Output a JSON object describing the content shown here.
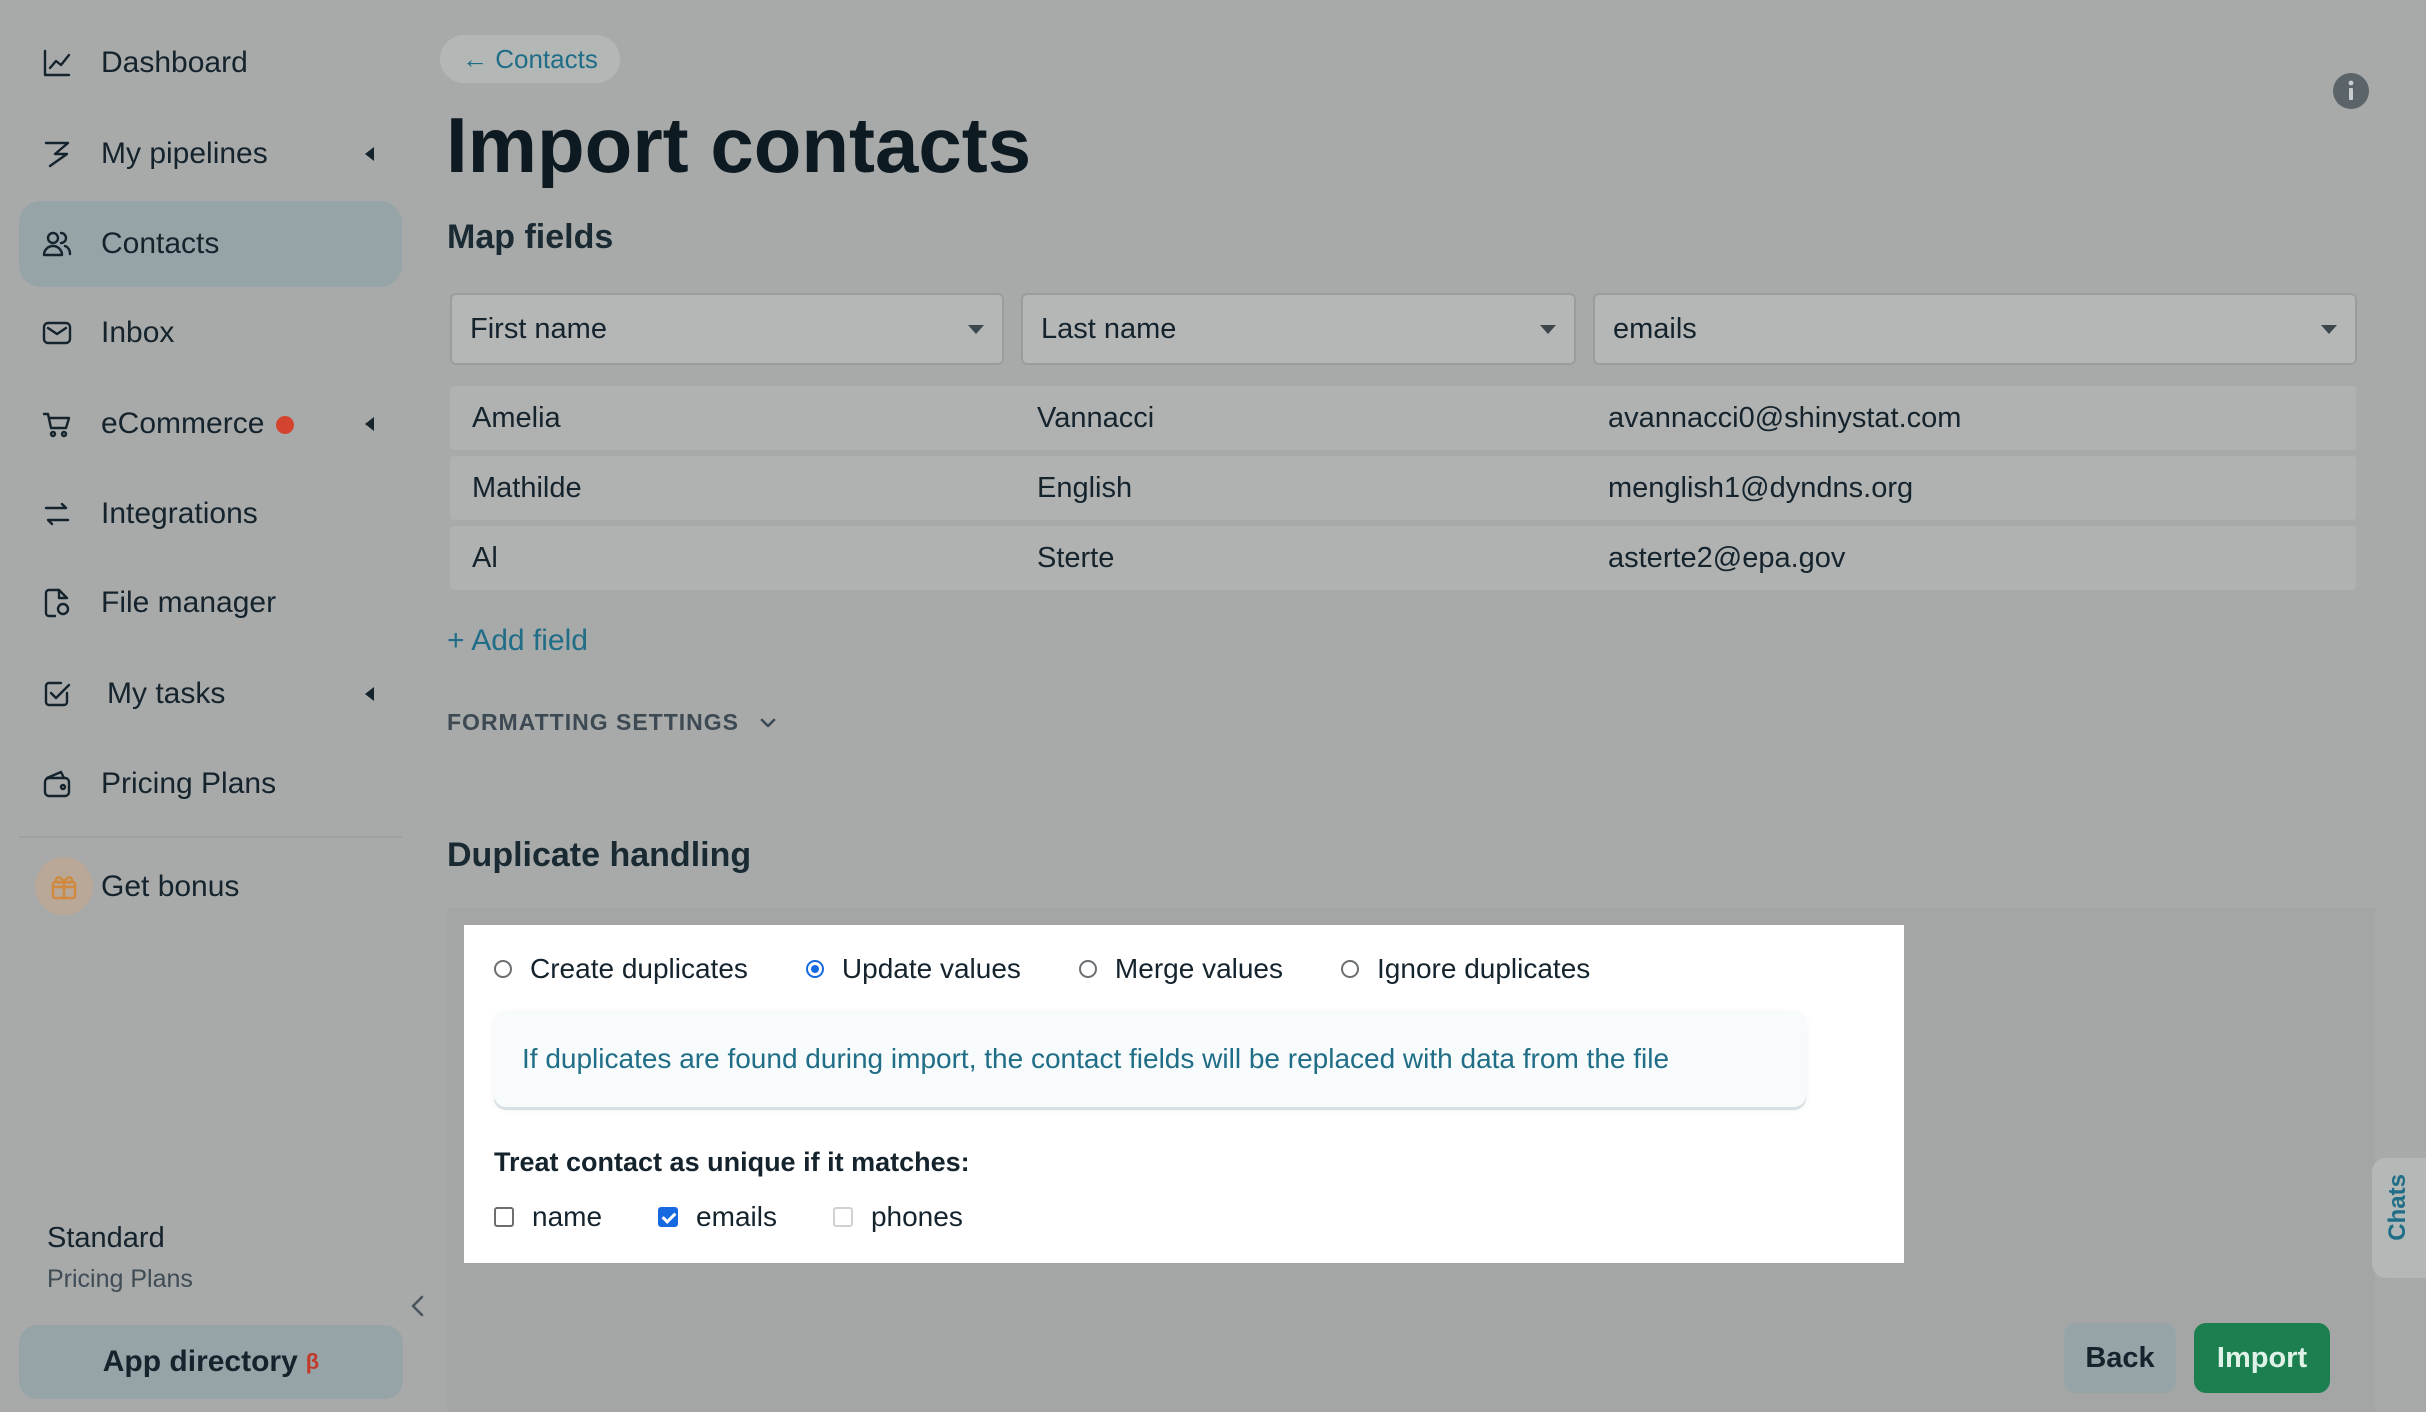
{
  "sidebar": {
    "items": [
      {
        "label": "Dashboard",
        "icon": "chart-line-icon"
      },
      {
        "label": "My pipelines",
        "icon": "pipeline-icon"
      },
      {
        "label": "Contacts",
        "icon": "contacts-icon"
      },
      {
        "label": "Inbox",
        "icon": "mail-icon"
      },
      {
        "label": "eCommerce",
        "icon": "cart-icon"
      },
      {
        "label": "Integrations",
        "icon": "arrows-exchange-icon"
      },
      {
        "label": "File manager",
        "icon": "file-icon"
      },
      {
        "label": "My tasks",
        "icon": "task-check-icon"
      },
      {
        "label": "Pricing Plans",
        "icon": "wallet-icon"
      }
    ],
    "bonus_label": "Get bonus",
    "plan_name": "Standard",
    "plan_sub": "Pricing Plans",
    "app_directory": "App directory",
    "app_directory_badge": "β"
  },
  "header": {
    "breadcrumb": "← Contacts",
    "title": "Import contacts"
  },
  "map_fields": {
    "title": "Map fields",
    "columns": [
      "First name",
      "Last name",
      "emails"
    ],
    "rows": [
      [
        "Amelia",
        "Vannacci",
        "avannacci0@shinystat.com"
      ],
      [
        "Mathilde",
        "English",
        "menglish1@dyndns.org"
      ],
      [
        "Al",
        "Sterte",
        "asterte2@epa.gov"
      ]
    ],
    "add_field": "+ Add field",
    "formatting_settings": "FORMATTING SETTINGS"
  },
  "duplicates": {
    "title": "Duplicate handling",
    "options": [
      "Create duplicates",
      "Update values",
      "Merge values",
      "Ignore duplicates"
    ],
    "selected_option": "Update values",
    "notice": "If duplicates are found during import, the contact fields will be replaced with data from the file",
    "unique_label": "Treat contact as unique if it matches:",
    "checks": [
      {
        "label": "name",
        "checked": false
      },
      {
        "label": "emails",
        "checked": true
      },
      {
        "label": "phones",
        "checked": false
      }
    ]
  },
  "actions": {
    "back": "Back",
    "import": "Import"
  },
  "chats_tab": "Chats",
  "colors": {
    "accent_blue": "#1f6d86",
    "import_green": "#1b7f4f",
    "notification_red": "#d4432e",
    "control_blue": "#1769e0"
  }
}
